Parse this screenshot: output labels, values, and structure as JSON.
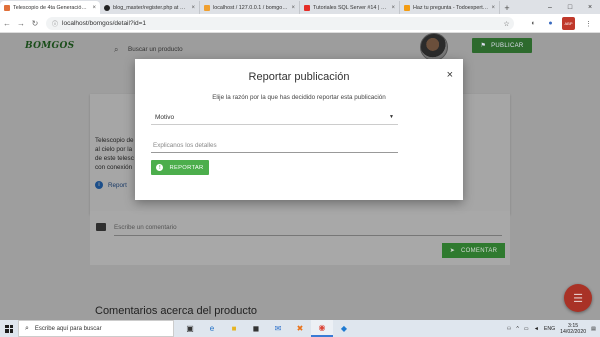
{
  "browser": {
    "tabs": [
      {
        "label": "Telescopio de 4ta Generación ...",
        "close": "×",
        "favicon_color": "#e0703a"
      },
      {
        "label": "blog_master/register.php at m...",
        "close": "×",
        "favicon_color": "#222222"
      },
      {
        "label": "localhost / 127.0.0.1 / bomgos ...",
        "close": "×",
        "favicon_color": "#f0a030"
      },
      {
        "label": "Tutoriales SQL Server #14 | Co...",
        "close": "×",
        "favicon_color": "#e52d27"
      },
      {
        "label": "Haz tu pregunta - Todoexpertos...",
        "close": "×",
        "favicon_color": "#f39c12"
      }
    ],
    "new_tab": "+",
    "url": "localhost/bomgos/detail?id=1",
    "window_controls": {
      "minimize": "–",
      "maximize": "□",
      "close": "×"
    }
  },
  "site": {
    "logo": "BOMGOS",
    "search_placeholder": "Buscar un producto",
    "publish_label": "PUBLICAR"
  },
  "product": {
    "description_lines": [
      "Telescopio de",
      "al cielo por la",
      "de este telesc",
      "con conexión"
    ],
    "report_link": "Report"
  },
  "comments": {
    "placeholder": "Escribe un comentario",
    "submit_label": "COMENTAR",
    "heading": "Comentarios acerca del producto"
  },
  "modal": {
    "title": "Reportar publicación",
    "close": "×",
    "subtitle": "Elije la razón por la que has decidido reportar esta publicación",
    "reason_select": "Motivo",
    "details_placeholder": "Explicanos los detalles",
    "submit_label": "REPORTAR"
  },
  "taskbar": {
    "search_placeholder": "Escribe aquí para buscar",
    "language": "ENG",
    "time": "3:15",
    "date": "14/02/2020"
  },
  "colors": {
    "accent_green": "#4cae4c",
    "fab_red": "#a93226"
  }
}
